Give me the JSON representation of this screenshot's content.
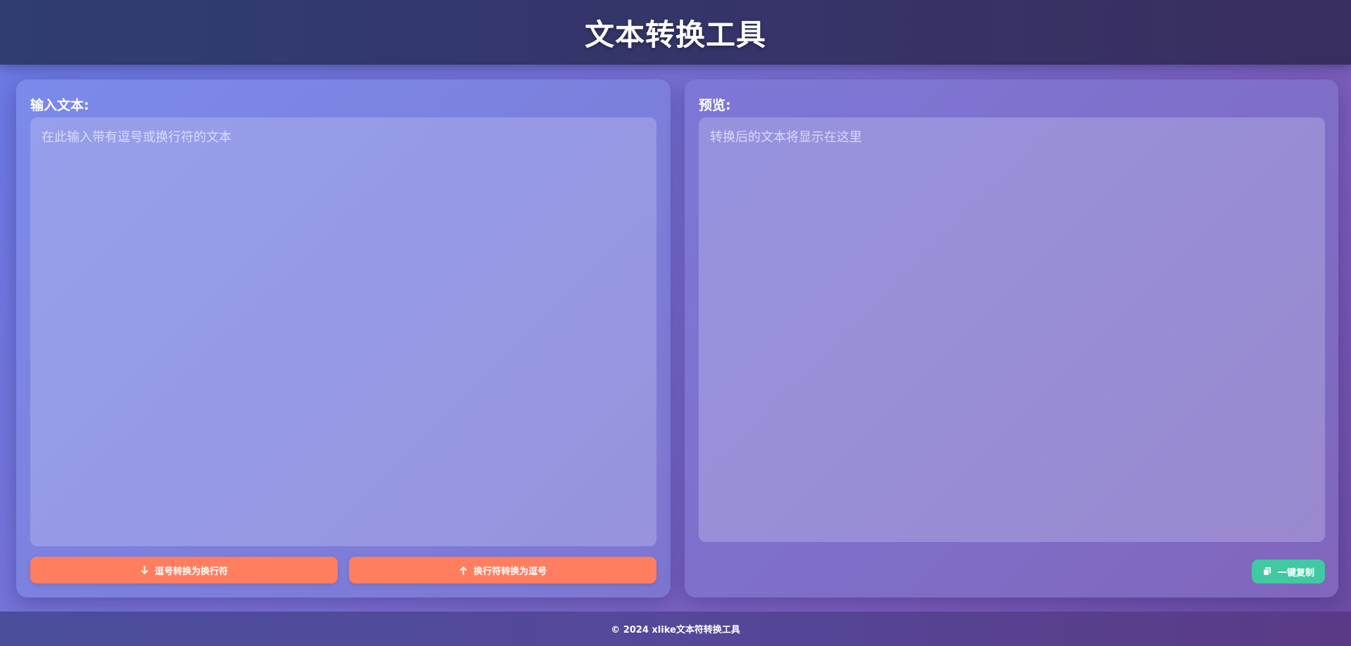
{
  "header": {
    "title": "文本转换工具"
  },
  "input_panel": {
    "label": "输入文本:",
    "placeholder": "在此输入带有逗号或换行符的文本",
    "value": ""
  },
  "buttons": {
    "comma_to_newline": {
      "label": "逗号转换为换行符",
      "icon": "arrow-down-icon"
    },
    "newline_to_comma": {
      "label": "换行符转换为逗号",
      "icon": "arrow-up-icon"
    }
  },
  "preview_panel": {
    "label": "预览:",
    "placeholder": "转换后的文本将显示在这里",
    "value": ""
  },
  "copy_button": {
    "label": "一键复制",
    "icon": "copy-icon"
  },
  "footer": {
    "text": "© 2024 xlike文本符转换工具"
  },
  "colors": {
    "primary_button": "#ff7e5f",
    "copy_button": "#40c9a2",
    "header_bg": "#2f3d70"
  }
}
